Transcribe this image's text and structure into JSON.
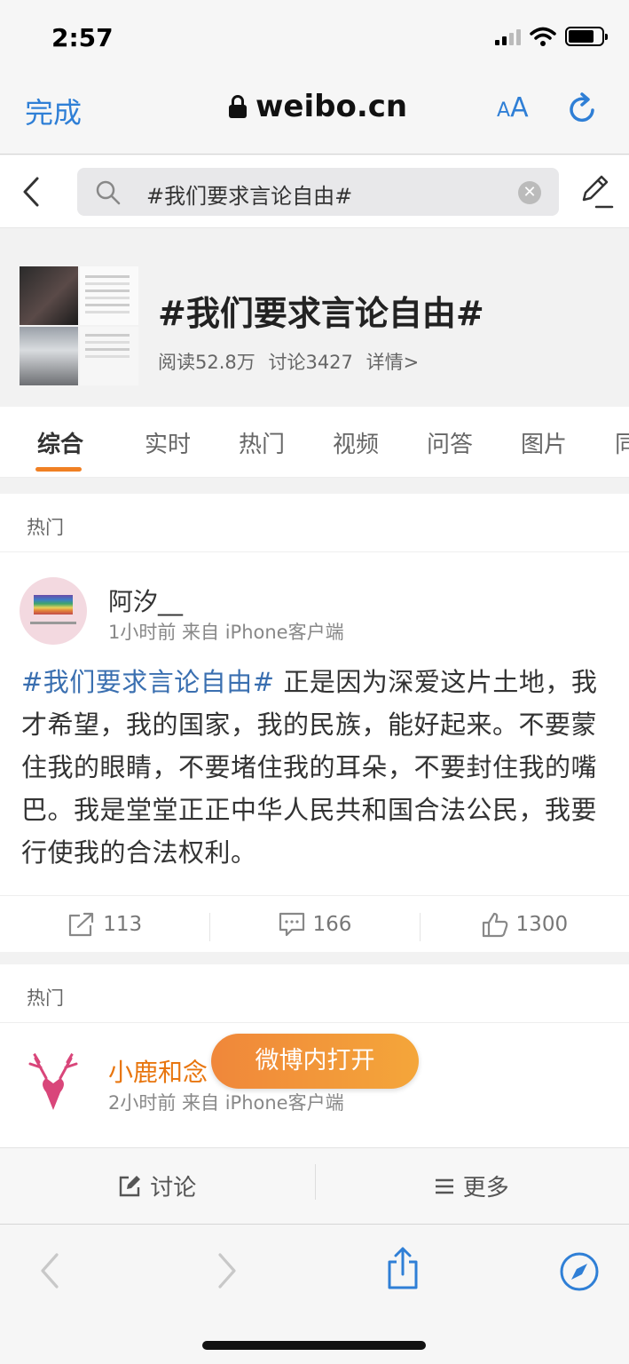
{
  "status_bar": {
    "time": "2:57"
  },
  "safari": {
    "done_label": "完成",
    "domain": "weibo.cn",
    "text_size_label_small": "A",
    "text_size_label_large": "A"
  },
  "search": {
    "query": "#我们要求言论自由#",
    "clear_label": "✕"
  },
  "topic": {
    "title": "#我们要求言论自由#",
    "reads": "阅读52.8万",
    "discussions": "讨论3427",
    "details": "详情>"
  },
  "tabs": [
    {
      "label": "综合",
      "active": true
    },
    {
      "label": "实时"
    },
    {
      "label": "热门"
    },
    {
      "label": "视频"
    },
    {
      "label": "问答"
    },
    {
      "label": "图片"
    },
    {
      "label": "同城"
    }
  ],
  "posts": [
    {
      "section_label": "热门",
      "author": "阿汐__",
      "meta": "1小时前  来自 iPhone客户端",
      "hashtag": "#我们要求言论自由#",
      "text": " 正是因为深爱这片土地，我才希望，我的国家，我的民族，能好起来。不要蒙住我的眼睛，不要堵住我的耳朵，不要封住我的嘴巴。我是堂堂正正中华人民共和国合法公民，我要行使我的合法权利。",
      "reposts": "113",
      "comments": "166",
      "likes": "1300"
    },
    {
      "section_label": "热门",
      "author": "小鹿和念",
      "meta": "2小时前  来自 iPhone客户端"
    }
  ],
  "open_in_app_label": "微博内打开",
  "weibo_bottom": {
    "discuss_label": "讨论",
    "more_label": "更多"
  },
  "colors": {
    "accent_blue": "#2f7fd6",
    "accent_orange": "#f08024",
    "link_blue": "#3a6fb0"
  }
}
